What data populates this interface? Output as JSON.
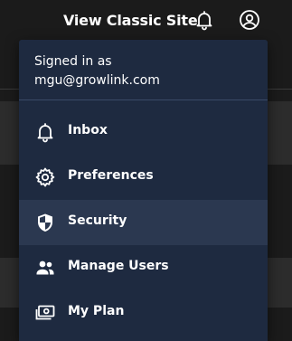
{
  "header": {
    "classic_link_label": "View Classic Site",
    "notification_icon": "bell-icon",
    "account_icon": "account-circle-icon"
  },
  "account_menu": {
    "signed_in_label": "Signed in as",
    "email": "mgu@growlink.com",
    "items": [
      {
        "label": "Inbox",
        "icon": "bell-icon",
        "active": false
      },
      {
        "label": "Preferences",
        "icon": "gear-icon",
        "active": false
      },
      {
        "label": "Security",
        "icon": "shield-icon",
        "active": true
      },
      {
        "label": "Manage Users",
        "icon": "users-icon",
        "active": false
      },
      {
        "label": "My Plan",
        "icon": "billing-icon",
        "active": false
      }
    ]
  },
  "colors": {
    "menu_background": "#1e2a40",
    "active_item_background": "#2b3850",
    "page_background": "#1b1b1b",
    "text": "#ffffff"
  }
}
